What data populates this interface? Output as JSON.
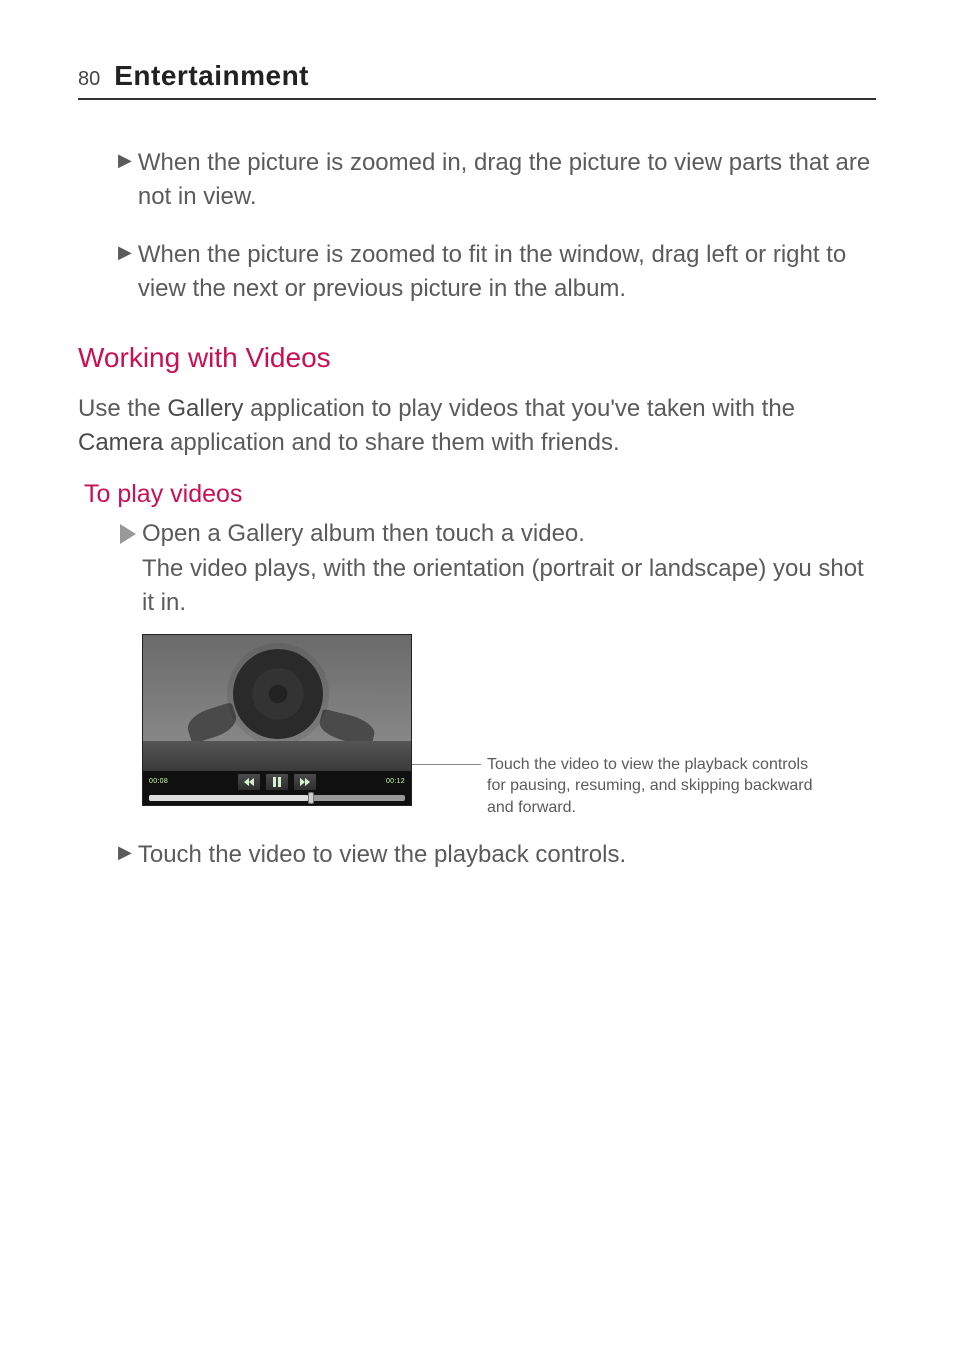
{
  "header": {
    "page_number": "80",
    "section": "Entertainment"
  },
  "bullets": {
    "zoom_drag": "When the picture is zoomed in, drag the picture to view parts that are not in view.",
    "zoom_fit": "When the picture is zoomed to fit in the window, drag left or right to view the next or previous picture in the album."
  },
  "h2": "Working with Videos",
  "intro": {
    "pre": "Use the ",
    "app1": "Gallery",
    "mid": " application to play videos that you've taken with the ",
    "app2": "Camera",
    "post": " application and to share them with friends."
  },
  "h3": "To play videos",
  "video_instructions": {
    "line1": "Open a Gallery album then touch a video.",
    "line2": "The video plays, with the orientation (portrait or landscape) you shot it in."
  },
  "player": {
    "time_left": "00:08",
    "time_right": "00:12"
  },
  "callout": "Touch the video to view the playback controls for pausing, resuming, and skipping backward and forward.",
  "touch_bullet": "Touch the video to view the playback controls."
}
